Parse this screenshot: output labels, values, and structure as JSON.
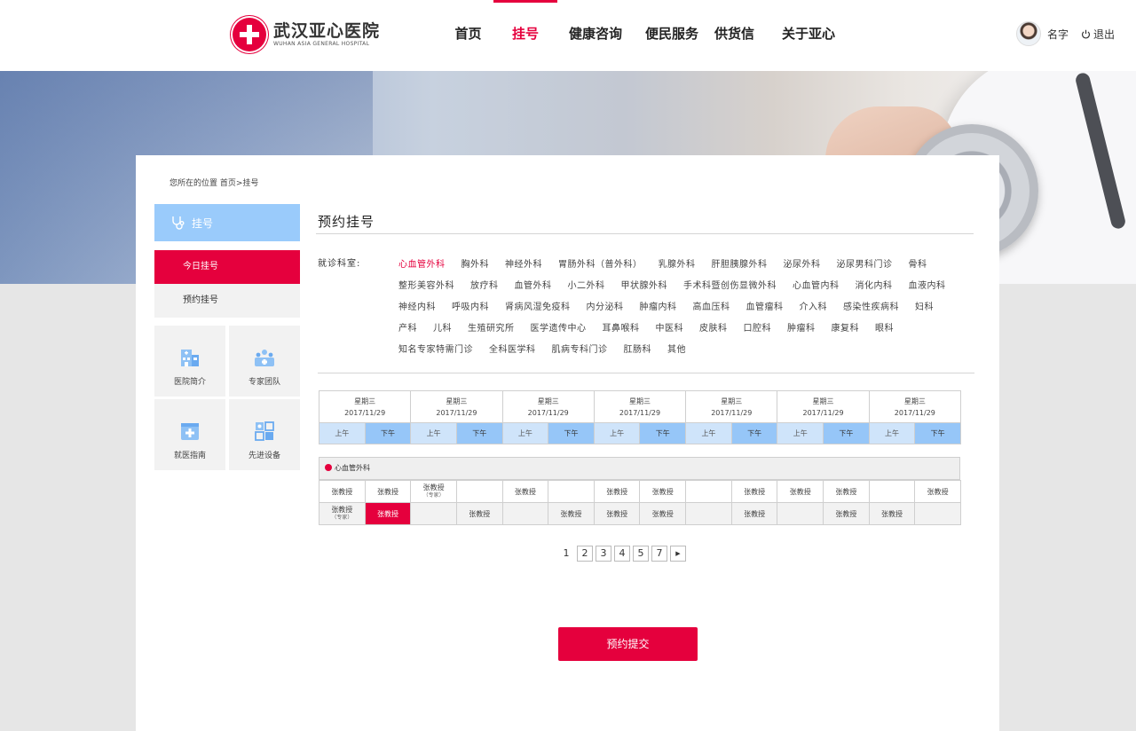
{
  "header": {
    "logo_cn": "武汉亚心医院",
    "logo_en": "WUHAN ASIA GENERAL HOSPITAL",
    "nav": [
      {
        "label": "首页",
        "active": false
      },
      {
        "label": "挂号",
        "active": true
      },
      {
        "label": "健康咨询",
        "active": false
      },
      {
        "label": "便民服务",
        "active": false
      },
      {
        "label": "供货信息",
        "active": false
      },
      {
        "label": "关于亚心",
        "active": false
      }
    ],
    "user_name": "名字",
    "logout_label": "退出"
  },
  "breadcrumb": "您所在的位置 首页>挂号",
  "sidebar": {
    "head_label": "挂号",
    "items": [
      {
        "label": "今日挂号",
        "active": true
      },
      {
        "label": "预约挂号",
        "active": false
      }
    ],
    "tiles": [
      {
        "label": "医院简介",
        "icon": "hospital-icon"
      },
      {
        "label": "专家团队",
        "icon": "team-icon"
      },
      {
        "label": "就医指南",
        "icon": "guide-icon"
      },
      {
        "label": "先进设备",
        "icon": "equipment-icon"
      }
    ]
  },
  "main": {
    "title": "预约挂号",
    "dept_label": "就诊科室:",
    "departments": [
      [
        "心血管外科",
        "胸外科",
        "神经外科",
        "胃肠外科（普外科）",
        "乳腺外科",
        "肝胆胰腺外科",
        "泌尿外科",
        "泌尿男科门诊",
        "骨科"
      ],
      [
        "整形美容外科",
        "放疗科",
        "血管外科",
        "小二外科",
        "甲状腺外科",
        "手术科暨创伤显微外科",
        "心血管内科",
        "消化内科",
        "血液内科"
      ],
      [
        "神经内科",
        "呼吸内科",
        "肾病风湿免疫科",
        "内分泌科",
        "肿瘤内科",
        "高血压科",
        "血管瘤科",
        "介入科",
        "感染性疾病科",
        "妇科"
      ],
      [
        "产科",
        "儿科",
        "生殖研究所",
        "医学遗传中心",
        "耳鼻喉科",
        "中医科",
        "皮肤科",
        "口腔科",
        "肿瘤科",
        "康复科",
        "眼科"
      ],
      [
        "知名专家特需门诊",
        "全科医学科",
        "肌病专科门诊",
        "肛肠科",
        "其他"
      ]
    ],
    "active_department": "心血管外科",
    "schedule": {
      "days": [
        {
          "weekday": "星期三",
          "date": "2017/11/29"
        },
        {
          "weekday": "星期三",
          "date": "2017/11/29"
        },
        {
          "weekday": "星期三",
          "date": "2017/11/29"
        },
        {
          "weekday": "星期三",
          "date": "2017/11/29"
        },
        {
          "weekday": "星期三",
          "date": "2017/11/29"
        },
        {
          "weekday": "星期三",
          "date": "2017/11/29"
        },
        {
          "weekday": "星期三",
          "date": "2017/11/29"
        }
      ],
      "am_label": "上午",
      "pm_label": "下午"
    },
    "doctor_section": {
      "dept_name": "心血管外科",
      "rows": [
        [
          {
            "name": "张教授",
            "sub": ""
          },
          {
            "name": "张教授",
            "sub": ""
          },
          {
            "name": "张教授",
            "sub": "（专家）"
          },
          {
            "name": "",
            "sub": ""
          },
          {
            "name": "张教授",
            "sub": ""
          },
          {
            "name": "",
            "sub": ""
          },
          {
            "name": "张教授",
            "sub": ""
          },
          {
            "name": "张教授",
            "sub": ""
          },
          {
            "name": "",
            "sub": ""
          },
          {
            "name": "张教授",
            "sub": ""
          },
          {
            "name": "张教授",
            "sub": ""
          },
          {
            "name": "张教授",
            "sub": ""
          },
          {
            "name": "",
            "sub": ""
          },
          {
            "name": "张教授",
            "sub": ""
          }
        ],
        [
          {
            "name": "张教授",
            "sub": "（专家）"
          },
          {
            "name": "张教授",
            "sub": "",
            "selected": true
          },
          {
            "name": "",
            "sub": ""
          },
          {
            "name": "张教授",
            "sub": ""
          },
          {
            "name": "",
            "sub": ""
          },
          {
            "name": "张教授",
            "sub": ""
          },
          {
            "name": "张教授",
            "sub": ""
          },
          {
            "name": "张教授",
            "sub": ""
          },
          {
            "name": "",
            "sub": ""
          },
          {
            "name": "张教授",
            "sub": ""
          },
          {
            "name": "",
            "sub": ""
          },
          {
            "name": "张教授",
            "sub": ""
          },
          {
            "name": "张教授",
            "sub": ""
          },
          {
            "name": "",
            "sub": ""
          }
        ]
      ]
    },
    "pagination": {
      "current": "1",
      "pages": [
        "2",
        "3",
        "4",
        "5",
        "7"
      ],
      "next": "▶"
    },
    "submit_label": "预约提交"
  },
  "colors": {
    "accent": "#e5003d",
    "side_head": "#9acbfb",
    "am_cell": "#cfe4fa",
    "pm_cell": "#96c6f8"
  }
}
